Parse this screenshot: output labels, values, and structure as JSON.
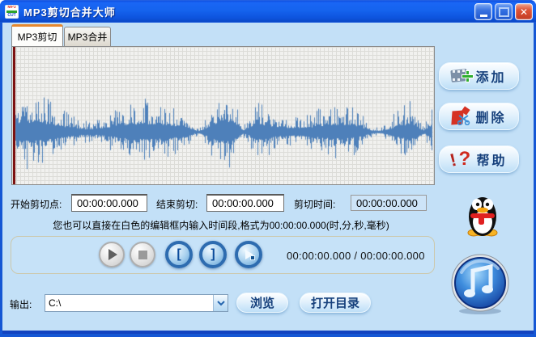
{
  "window": {
    "title": "MP3剪切合并大师",
    "controls": {
      "close_glyph": "✕"
    }
  },
  "tabs": [
    {
      "label": "MP3剪切",
      "active": true
    },
    {
      "label": "MP3合并",
      "active": false
    }
  ],
  "fields": {
    "start_label": "开始剪切点:",
    "start_value": "00:00:00.000",
    "end_label": "结束剪切:",
    "end_value": "00:00:00.000",
    "duration_label": "剪切时间:",
    "duration_value": "00:00:00.000"
  },
  "hint": "您也可以直接在白色的编辑框内输入时间段,格式为00:00:00.000(时,分,秒,毫秒)",
  "player": {
    "mark_start_glyph": "[",
    "mark_end_glyph": "]",
    "time_display": "00:00:00.000 / 00:00:00.000"
  },
  "output": {
    "label": "输出:",
    "path": "C:\\",
    "browse_label": "浏览",
    "open_dir_label": "打开目录"
  },
  "side_buttons": [
    {
      "label": "添加"
    },
    {
      "label": "删除"
    },
    {
      "label": "帮助"
    }
  ],
  "waveform": {
    "color": "#4e80ba",
    "seed": 47,
    "center": 0.62
  },
  "colors": {
    "titlebar_blue": "#1563ee",
    "client_bg": "#c3e0f7",
    "wave_grid_bg": "#f1f1ef",
    "cursor_red": "#7c1212",
    "button_text": "#16407c",
    "tab_accent_orange": "#e6882e"
  }
}
